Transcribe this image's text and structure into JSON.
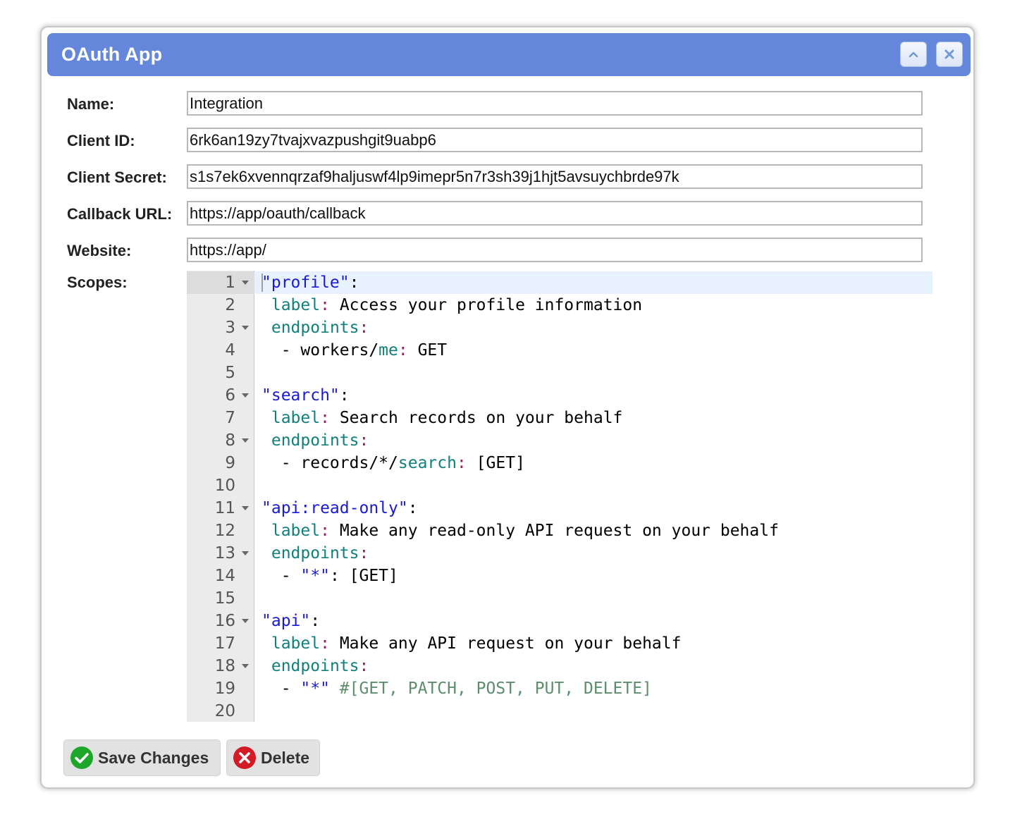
{
  "dialog": {
    "title": "OAuth App"
  },
  "form": {
    "name": {
      "label": "Name:",
      "value": "Integration"
    },
    "client_id": {
      "label": "Client ID:",
      "value": "6rk6an19zy7tvajxvazpushgit9uabp6"
    },
    "client_secret": {
      "label": "Client Secret:",
      "value": "s1s7ek6xvennqrzaf9haljuswf4lp9imepr5n7r3sh39j1hjt5avsuychbrde97k"
    },
    "callback_url": {
      "label": "Callback URL:",
      "value": "https://app/oauth/callback"
    },
    "website": {
      "label": "Website:",
      "value": "https://app/"
    },
    "scopes": {
      "label": "Scopes:"
    }
  },
  "editor": {
    "lines": [
      {
        "n": "1",
        "fold": true,
        "active": true,
        "tokens": [
          [
            "str",
            "\"profile\""
          ],
          [
            "txt",
            ":"
          ]
        ]
      },
      {
        "n": "2",
        "tokens": [
          [
            "txt",
            " "
          ],
          [
            "key",
            "label"
          ],
          [
            "pun",
            ":"
          ],
          [
            "txt",
            " Access your profile information"
          ]
        ]
      },
      {
        "n": "3",
        "fold": true,
        "tokens": [
          [
            "txt",
            " "
          ],
          [
            "key",
            "endpoints"
          ],
          [
            "pun",
            ":"
          ]
        ]
      },
      {
        "n": "4",
        "tokens": [
          [
            "txt",
            "  - workers/"
          ],
          [
            "key",
            "me"
          ],
          [
            "pun",
            ":"
          ],
          [
            "txt",
            " GET"
          ]
        ]
      },
      {
        "n": "5",
        "tokens": []
      },
      {
        "n": "6",
        "fold": true,
        "tokens": [
          [
            "str",
            "\"search\""
          ],
          [
            "txt",
            ":"
          ]
        ]
      },
      {
        "n": "7",
        "tokens": [
          [
            "txt",
            " "
          ],
          [
            "key",
            "label"
          ],
          [
            "pun",
            ":"
          ],
          [
            "txt",
            " Search records on your behalf"
          ]
        ]
      },
      {
        "n": "8",
        "fold": true,
        "tokens": [
          [
            "txt",
            " "
          ],
          [
            "key",
            "endpoints"
          ],
          [
            "pun",
            ":"
          ]
        ]
      },
      {
        "n": "9",
        "tokens": [
          [
            "txt",
            "  - records/*/"
          ],
          [
            "key",
            "search"
          ],
          [
            "pun",
            ":"
          ],
          [
            "txt",
            " [GET]"
          ]
        ]
      },
      {
        "n": "10",
        "tokens": []
      },
      {
        "n": "11",
        "fold": true,
        "tokens": [
          [
            "str",
            "\"api:read-only\""
          ],
          [
            "txt",
            ":"
          ]
        ]
      },
      {
        "n": "12",
        "tokens": [
          [
            "txt",
            " "
          ],
          [
            "key",
            "label"
          ],
          [
            "pun",
            ":"
          ],
          [
            "txt",
            " Make any read-only API request on your behalf"
          ]
        ]
      },
      {
        "n": "13",
        "fold": true,
        "tokens": [
          [
            "txt",
            " "
          ],
          [
            "key",
            "endpoints"
          ],
          [
            "pun",
            ":"
          ]
        ]
      },
      {
        "n": "14",
        "tokens": [
          [
            "txt",
            "  - "
          ],
          [
            "str",
            "\"*\""
          ],
          [
            "txt",
            ": [GET]"
          ]
        ]
      },
      {
        "n": "15",
        "tokens": []
      },
      {
        "n": "16",
        "fold": true,
        "tokens": [
          [
            "str",
            "\"api\""
          ],
          [
            "txt",
            ":"
          ]
        ]
      },
      {
        "n": "17",
        "tokens": [
          [
            "txt",
            " "
          ],
          [
            "key",
            "label"
          ],
          [
            "pun",
            ":"
          ],
          [
            "txt",
            " Make any API request on your behalf"
          ]
        ]
      },
      {
        "n": "18",
        "fold": true,
        "tokens": [
          [
            "txt",
            " "
          ],
          [
            "key",
            "endpoints"
          ],
          [
            "pun",
            ":"
          ]
        ]
      },
      {
        "n": "19",
        "tokens": [
          [
            "txt",
            "  - "
          ],
          [
            "str",
            "\"*\""
          ],
          [
            "txt",
            " "
          ],
          [
            "com",
            "#[GET, PATCH, POST, PUT, DELETE]"
          ]
        ]
      },
      {
        "n": "20",
        "tokens": []
      }
    ]
  },
  "actions": {
    "save_label": "Save Changes",
    "delete_label": "Delete"
  },
  "icons": {
    "collapse": "chevron-up-icon",
    "close": "close-icon",
    "save": "check-circle-icon",
    "delete": "x-circle-icon"
  },
  "colors": {
    "titlebar": "#6587db",
    "save_icon": "#1fa72b",
    "delete_icon": "#d21b24",
    "editor_string": "#1a1ad6",
    "editor_key": "#117f7a",
    "editor_comment": "#5d8d6d"
  }
}
